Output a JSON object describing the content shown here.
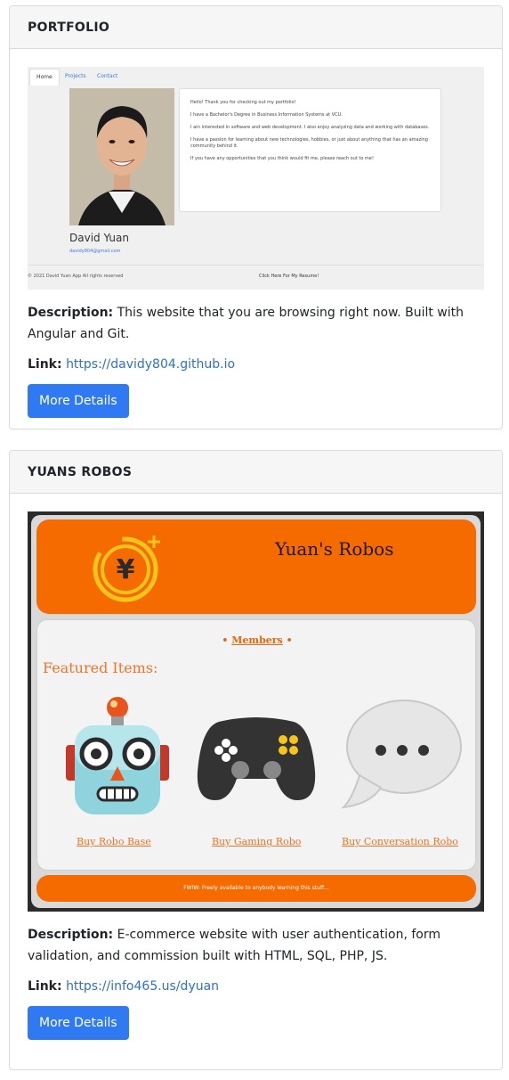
{
  "projects": [
    {
      "title": "PORTFOLIO",
      "description_label": "Description:",
      "description": "This website that you are browsing right now. Built with Angular and Git.",
      "link_label": "Link:",
      "link": "https://davidy804.github.io",
      "button": "More Details",
      "screenshot": {
        "tabs": [
          "Home",
          "Projects",
          "Contact"
        ],
        "about": [
          "Hello! Thank you for checking out my portfolio!",
          "I have a Bachelor's Degree in Business Information Systems at VCU.",
          "I am interested in software and web development. I also enjoy analyzing data and working with databases.",
          "I have a passion for learning about new technologies, hobbies, or just about anything that has an amazing community behind it.",
          "If you have any opportunities that you think would fit me, please reach out to me!"
        ],
        "name": "David Yuan",
        "email": "davidy804@gmail.com",
        "footer_left": "© 2021 David Yuan App All rights reserved",
        "footer_right": "Click Here For My Resume!"
      }
    },
    {
      "title": "YUANS ROBOS",
      "description_label": "Description:",
      "description": "E-commerce website with user authentication, form validation, and commission built with HTML, SQL, PHP, JS.",
      "link_label": "Link:",
      "link": "https://info465.us/dyuan",
      "button": "More Details",
      "screenshot": {
        "site_title": "Yuan's Robos",
        "members": "Members",
        "featured": "Featured Items:",
        "items": [
          "Buy Robo Base",
          "Buy Gaming Robo",
          "Buy Conversation Robo"
        ],
        "footer": "FWIW: Freely available to anybody learning this stuff..."
      }
    }
  ],
  "colors": {
    "button": "#2f7af2",
    "link": "#2f6fd1",
    "robo_orange": "#f56b00"
  }
}
